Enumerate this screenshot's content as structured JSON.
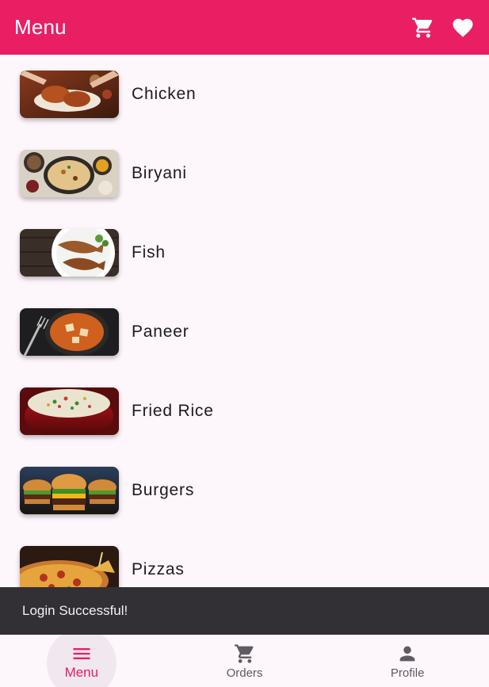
{
  "app_bar": {
    "title": "Menu",
    "cart_icon": "shopping-cart-icon",
    "favorite_icon": "heart-icon",
    "color": "#ea1e63"
  },
  "menu": {
    "items": [
      {
        "label": "Chicken"
      },
      {
        "label": "Biryani"
      },
      {
        "label": "Fish"
      },
      {
        "label": "Paneer"
      },
      {
        "label": "Fried Rice"
      },
      {
        "label": "Burgers"
      },
      {
        "label": "Pizzas"
      }
    ]
  },
  "snackbar": {
    "message": "Login Successful!"
  },
  "bottom_nav": {
    "items": [
      {
        "label": "Menu",
        "icon": "menu-icon",
        "active": true
      },
      {
        "label": "Orders",
        "icon": "shopping-cart-icon",
        "active": false
      },
      {
        "label": "Profile",
        "icon": "person-icon",
        "active": false
      }
    ]
  }
}
